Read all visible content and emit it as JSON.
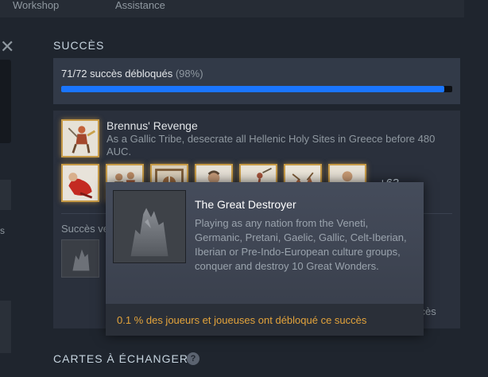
{
  "topnav": {
    "workshop": "Workshop",
    "assistance": "Assistance"
  },
  "achievements": {
    "section_title": "SUCCÈS",
    "progress_label": "71/72 succès débloqués",
    "progress_percent": "(98%)",
    "progress_fraction": 0.98,
    "featured": {
      "title": "Brennus' Revenge",
      "description": "As a Gallic Tribe, desecrate all Hellenic Holy Sites in Greece before 480 AUC."
    },
    "more_count": "+63",
    "locked_label": "Succès ve",
    "view_all_fragment": "ccès"
  },
  "tooltip": {
    "title": "The Great Destroyer",
    "description": "Playing as any nation from the Veneti, Germanic, Pretani, Gaelic, Gallic, Celt-Iberian, Iberian or Pre-Indo-European culture groups, conquer and destroy 10 Great Wonders.",
    "footer": "0.1 % des joueurs et joueuses ont débloqué ce succès"
  },
  "cards": {
    "section_title": "CARTES À ÉCHANGER",
    "help": "?"
  },
  "colors": {
    "background": "#1f252e",
    "panel": "#2a303c",
    "progress": "#1a75ff",
    "gold_border": "#c79b47",
    "rarity": "#e3a33b"
  }
}
